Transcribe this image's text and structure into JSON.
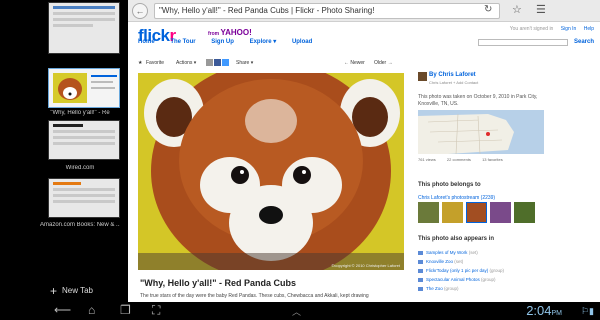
{
  "tabs": [
    {
      "caption": "",
      "active": false
    },
    {
      "caption": "\"Why, Hello y'all!\" - Re",
      "active": true
    },
    {
      "caption": "Wired.com",
      "active": false
    },
    {
      "caption": "Amazon.com Books: New & ...",
      "active": false
    }
  ],
  "new_tab_label": "New Tab",
  "browser": {
    "url": "\"Why, Hello y'all!\" - Red Panda Cubs | Flickr - Photo Sharing!",
    "back_icon": "back-arrow-icon",
    "reload_icon": "reload-icon",
    "bookmark_icon": "star-icon",
    "menu_icon": "menu-icon"
  },
  "flickr": {
    "logo_text_blue": "flick",
    "logo_text_pink": "r",
    "yahoo_from": "from",
    "yahoo": "YAHOO!",
    "signed_out": "You aren't signed in",
    "sign_in": "Sign In",
    "help": "Help",
    "nav": [
      "Home",
      "The Tour",
      "Sign Up",
      "Explore ▾",
      "Upload"
    ],
    "search_label": "Search",
    "toolbar": {
      "favorite": "Favorite",
      "actions": "Actions ▾",
      "share": "Share ▾",
      "newer": "← Newer",
      "older": "Older →"
    },
    "photo_credit": "©copyright © 2010 Christopher Laforet",
    "photo_title": "\"Why, Hello y'all!\" - Red Panda Cubs",
    "photo_desc": "The true stars of the day were the baby Red Pandas. These cubs, Chewbacca and Akkali, kept drawing",
    "owner": {
      "name": "By Chris Laforet",
      "sub": "Chris Laforet   + Add Contact"
    },
    "taken": "This photo was taken on October 9, 2010 in Park City, Knoxville, TN, US.",
    "stats": {
      "views": "761 views",
      "comments": "22 comments",
      "favorites": "13 favorites"
    },
    "belongs_title": "This photo belongs to",
    "stream_link": "Chris Laforet's photostream (2239)",
    "appears_title": "This photo also appears in",
    "appears": [
      {
        "label": "Samples of My Work",
        "count": "(set)"
      },
      {
        "label": "Knoxville Zoo",
        "count": "(set)"
      },
      {
        "label": "FlickrToday (only 1 pic per day)",
        "count": "(group)"
      },
      {
        "label": "Spectacular Animal Photos",
        "count": "(group)"
      },
      {
        "label": "The Zoo",
        "count": "(group)"
      }
    ]
  },
  "system": {
    "clock": "2:04",
    "clock_suffix": "PM",
    "nav_icons": [
      "back-icon",
      "home-icon",
      "recent-apps-icon",
      "screenshot-icon"
    ]
  }
}
